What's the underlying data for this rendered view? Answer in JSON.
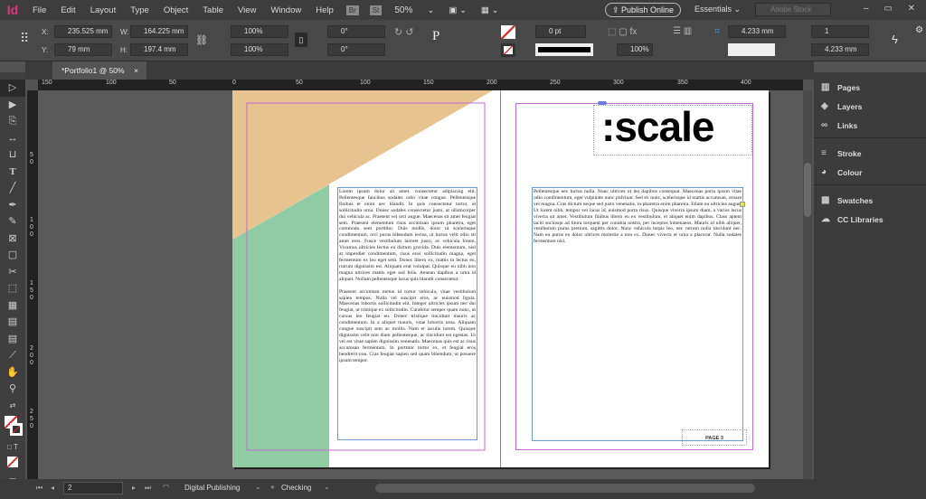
{
  "app": {
    "logo": "Id",
    "zoom": "50%",
    "bridge": "Br",
    "stock": "St"
  },
  "menu": [
    "File",
    "Edit",
    "Layout",
    "Type",
    "Object",
    "Table",
    "View",
    "Window",
    "Help"
  ],
  "header": {
    "publish": "Publish Online",
    "workspace": "Essentials",
    "search_placeholder": "Adobe Stock"
  },
  "control": {
    "x_label": "X:",
    "x": "235.525 mm",
    "y_label": "Y:",
    "y": "79 mm",
    "w_label": "W:",
    "w": "164.225 mm",
    "h_label": "H:",
    "h": "197.4 mm",
    "scale_x": "100%",
    "scale_y": "100%",
    "rotate": "0°",
    "shear": "0°",
    "stroke_weight": "0 pt",
    "opacity": "100%",
    "inset": "4.233 mm",
    "columns": "1",
    "gutter": "4.233 mm"
  },
  "document_tab": {
    "title": "*Portfolio1 @ 50%",
    "close": "×"
  },
  "ruler": {
    "h": [
      "150",
      "100",
      "50",
      "0",
      "50",
      "100",
      "150",
      "200",
      "250",
      "300",
      "350",
      "400"
    ],
    "v": [
      "5",
      "0",
      "1",
      "0",
      "0",
      "1",
      "5",
      "0",
      "2",
      "0",
      "0",
      "2",
      "5",
      "0"
    ]
  },
  "panels": [
    {
      "label": "Pages",
      "icon": "pages-icon"
    },
    {
      "label": "Layers",
      "icon": "layers-icon"
    },
    {
      "label": "Links",
      "icon": "links-icon"
    },
    {
      "label": "Stroke",
      "icon": "stroke-icon"
    },
    {
      "label": "Colour",
      "icon": "colour-icon"
    },
    {
      "label": "Swatches",
      "icon": "swatches-icon"
    },
    {
      "label": "CC Libraries",
      "icon": "cc-libraries-icon"
    }
  ],
  "status": {
    "page": "2",
    "preset": "Digital Publishing",
    "preflight": "Checking"
  },
  "pages": {
    "left_p1": "Lorem ipsum dolor sit amet, consectetur adipiscing elit. Pellentesque faucibus sodales odio vitae congue. Pellentesque finibus et enim nec blandit. In quis consectetur tortor, at sollicitudin urna. Donec sodales consectetur justo, at ullamcorper dui vehicula ac. Praesent vel orci augue. Maecenas sit amet feugiat sem. Praesent elementum risus accumsan ipsum pharetra, eget commodo sem porttitor. Duis mollis, dolor ut scelerisque condimentum, orci purus bibendum lectus, ut luctus velit odio sit amet eros. Fusce vestibulum laoreet justo, ac vehicula lorem. Vivamus ultricies lectus eu dictum gravida. Duis elementum, nisl at imperdiet condimentum, risus eros sollicitudin magna, eget fermentum ex leo eget sem. Donec libero ex, mattis in lectus eu, rutrum dignissim est. Aliquam erat volutpat. Quisque eu nibh non magna ultrices mattis eget sed felis. Aenean dapibus a urna id aliquet. Nullam pellentesque lacus quis blandit consectetur.",
    "left_p2": "Praesent accumsan metus id tortor vehicula, vitae vestibulum sapien tempus. Nulla vel suscipit eros, ac euismod ligula. Maecenas lobortis sollicitudin elit. Integer ultricies ipsum nec dui feugiat, ut tristique ex sollicitudin. Curabitur semper quam nunc, ut cursus leo feugiat eu. Donec tristique tincidunt mauris ac condimentum. In a aliquet mauris, vitae lobortis urna. Aliquam congue suscipit sem ac mollis. Nam et iaculis lorem. Quisque dignissim velit non diam pellentesque, ac tincidunt est egestas. Ut vel est vitae sapien dignissim venenatis. Maecenas quis est ac risus accumsan fermentum. In porttitor tortor ex, et feugiat eros hendrerit non. Cras feugiat sapien sed quam bibendum, ut posuere ipsum tempor.",
    "right_p1": "Pellentesque nec luctus nulla. Nunc ultrices ut leo dapibus consequat. Maecenas porta ipsum vitae odio condimentum, eget vulputate nunc pulvinar. Sed ex nunc, scelerisque id mattis accumsan, ornare vel magna. Cras dictum neque sed justo venenatis, in pharetra enim pharetra. Etiam eu ultricies augue. Ut lorem nibh, tempor vel lacus id, euismod porta risus. Quisque viverra ipsum diam, a varius lacus viverra sit amet. Vestibulum finibus libero eu ex vestibulum, et aliquet enim dapibus. Class aptent taciti sociosqu ad litora torquent per conubia nostra, per inceptos himenaeos. Mauris id nibh aliquet, vestibulum purus pretium, sagittis dolor. Nunc vehicula turpis leo, nec rutrum nulla tincidunt nec. Nam eu purus eu dolor ultrices molestie a non ex. Donec viverra et urna a placerat. Nulla sodales fermentum nisl.",
    "logo_text": ":scale",
    "folio": "PAGE 3"
  },
  "colors": {
    "orange": "#e6c38f",
    "green": "#8fcca4",
    "margin": "#c36ad6",
    "frame": "#6a9ad8"
  }
}
